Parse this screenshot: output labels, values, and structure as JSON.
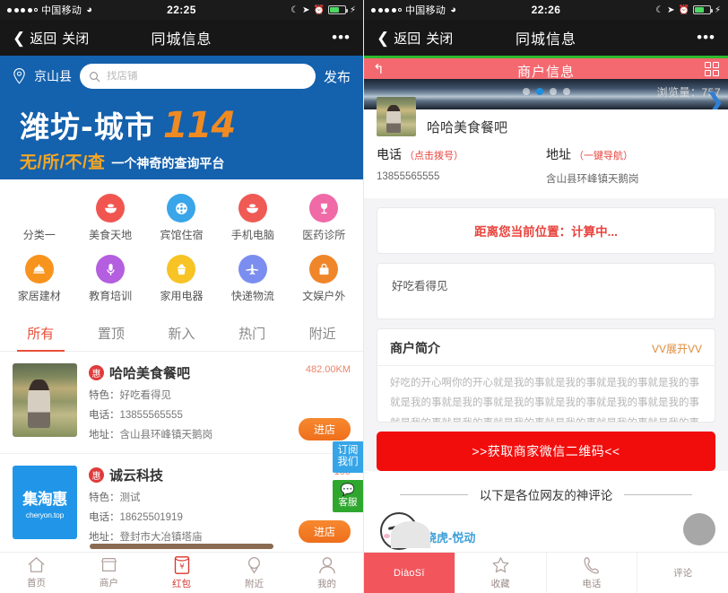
{
  "left": {
    "status": {
      "carrier": "中国移动",
      "time": "22:25"
    },
    "nav": {
      "back": "返回",
      "close": "关闭",
      "title": "同城信息",
      "more": "•••"
    },
    "search": {
      "city": "京山县",
      "placeholder": "找店铺",
      "value": "",
      "publish": "发布"
    },
    "banner": {
      "city": "潍坊-城市",
      "number": "114",
      "slogan": "无/所/不/查",
      "sub": "一个神奇的查询平台"
    },
    "categories": [
      {
        "label": "分类一",
        "icon": "blank-icon",
        "color": "#ffffff"
      },
      {
        "label": "美食天地",
        "icon": "bowl-icon",
        "color": "#f0564f"
      },
      {
        "label": "宾馆住宿",
        "icon": "film-reel-icon",
        "color": "#3aa5e8"
      },
      {
        "label": "手机电脑",
        "icon": "bowl-icon",
        "color": "#f05a55"
      },
      {
        "label": "医药诊所",
        "icon": "goblet-icon",
        "color": "#ef6aa6"
      },
      {
        "label": "家居建材",
        "icon": "cloche-icon",
        "color": "#f7941e"
      },
      {
        "label": "教育培训",
        "icon": "microphone-icon",
        "color": "#b45ee0"
      },
      {
        "label": "家用电器",
        "icon": "cupcake-icon",
        "color": "#f7c325"
      },
      {
        "label": "快递物流",
        "icon": "airplane-icon",
        "color": "#7b8ef0"
      },
      {
        "label": "文娱户外",
        "icon": "handbag-icon",
        "color": "#f0862a"
      }
    ],
    "tabs": [
      {
        "label": "所有",
        "active": true
      },
      {
        "label": "置顶",
        "active": false
      },
      {
        "label": "新入",
        "active": false
      },
      {
        "label": "热门",
        "active": false
      },
      {
        "label": "附近",
        "active": false
      }
    ],
    "listings": [
      {
        "badge": "惠",
        "title": "哈哈美食餐吧",
        "feature_key": "特色：",
        "feature": "好吃看得见",
        "phone_key": "电话：",
        "phone": "13855565555",
        "address_key": "地址：",
        "address": "含山县环峰镇天鹅岗",
        "distance": "482.00KM",
        "enter": "进店"
      },
      {
        "badge": "惠",
        "title": "诚云科技",
        "feature_key": "特色：",
        "feature": "测试",
        "phone_key": "电话：",
        "phone": "18625501919",
        "address_key": "地址：",
        "address": "登封市大冶镇塔庙",
        "distance": "100",
        "enter": "进店",
        "logo_main": "集淘惠",
        "logo_sub": "cheryon.top"
      }
    ],
    "float": {
      "subscribe": "订阅\n我们",
      "subscribe_l1": "订阅",
      "subscribe_l2": "我们",
      "service": "客服"
    },
    "tabbar": [
      {
        "label": "首页",
        "icon": "home-icon",
        "hot": false
      },
      {
        "label": "商户",
        "icon": "shop-icon",
        "hot": false
      },
      {
        "label": "红包",
        "icon": "redpacket-icon",
        "hot": true
      },
      {
        "label": "附近",
        "icon": "location-icon",
        "hot": false
      },
      {
        "label": "我的",
        "icon": "person-icon",
        "hot": false
      }
    ]
  },
  "right": {
    "status": {
      "carrier": "中国移动",
      "time": "22:26"
    },
    "nav": {
      "back": "返回",
      "close": "关闭",
      "title": "同城信息",
      "more": "•••"
    },
    "inner_header": {
      "title": "商户信息",
      "views": "浏览量：757"
    },
    "shop": {
      "name": "哈哈美食餐吧"
    },
    "contact": {
      "phone_label": "电话",
      "phone_hint": "（点击拨号）",
      "phone": "13855565555",
      "address_label": "地址",
      "address_hint": "（一键导航）",
      "address": "含山县环峰镇天鹅岗"
    },
    "distance_card": "距离您当前位置：计算中...",
    "feature_card": "好吃看得见",
    "intro": {
      "title": "商户简介",
      "expand": "VV展开VV",
      "body": "好吃的开心啊你的开心就是我的事就是我的事就是我的事就是我的事就是我的事就是我的事就是我的事就是我的事就是我的事就是我的事就是我的事就是我的事就是我的事就是我的事就是我的事就是我的事"
    },
    "qr_button": ">>获取商家微信二维码<<",
    "comments_header": "以下是各位网友的神评论",
    "comment_author": "饶虎-悦动",
    "tabbar": [
      {
        "label": "DiàoSī",
        "icon": "brand-icon",
        "filled": true
      },
      {
        "label": "收藏",
        "icon": "star-icon",
        "filled": false
      },
      {
        "label": "电话",
        "icon": "phone-icon",
        "filled": false
      },
      {
        "label": "评论",
        "icon": "comment-icon",
        "filled": false
      }
    ]
  }
}
